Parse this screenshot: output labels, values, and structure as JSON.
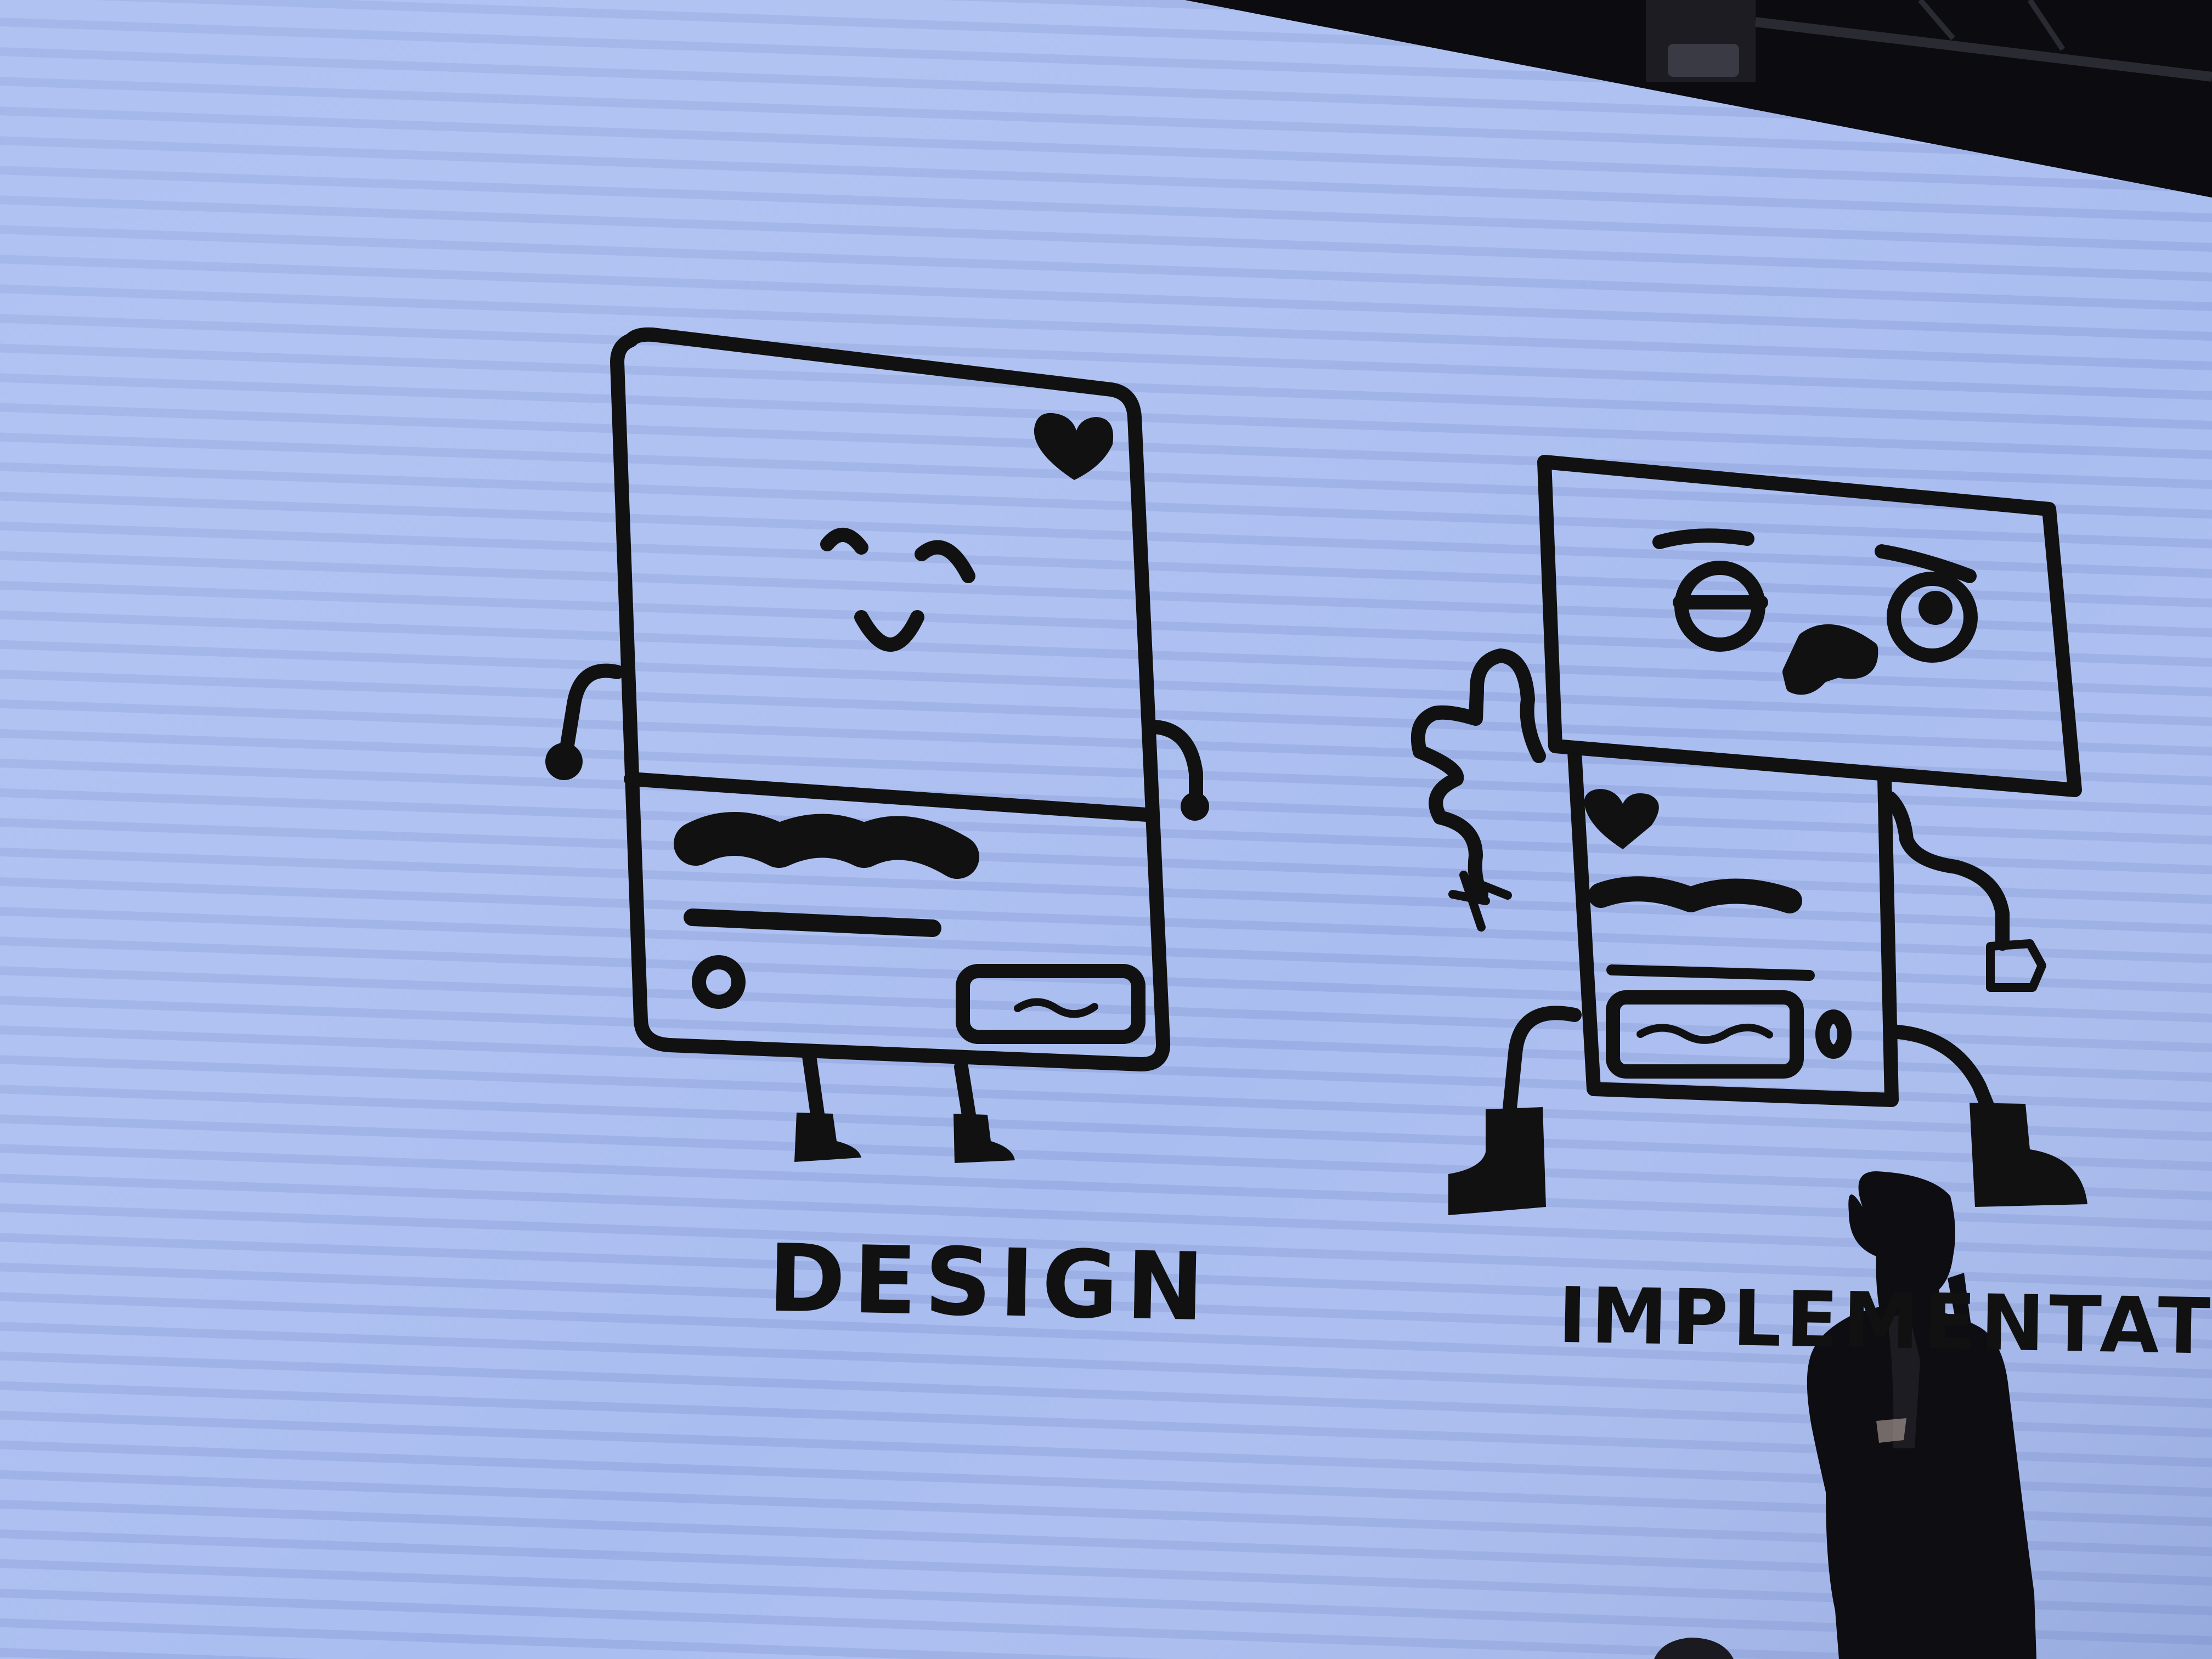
{
  "slide": {
    "left_caption": "DESIGN",
    "right_caption": "IMPLEMENTATION"
  },
  "colors": {
    "screen": "#a9bdf0",
    "screen_stripe": "#93a8e0",
    "ink": "#111111",
    "ceiling": "#0b0b10"
  },
  "icons": {
    "design_card_heart": "heart-icon",
    "impl_card_heart": "heart-icon"
  }
}
